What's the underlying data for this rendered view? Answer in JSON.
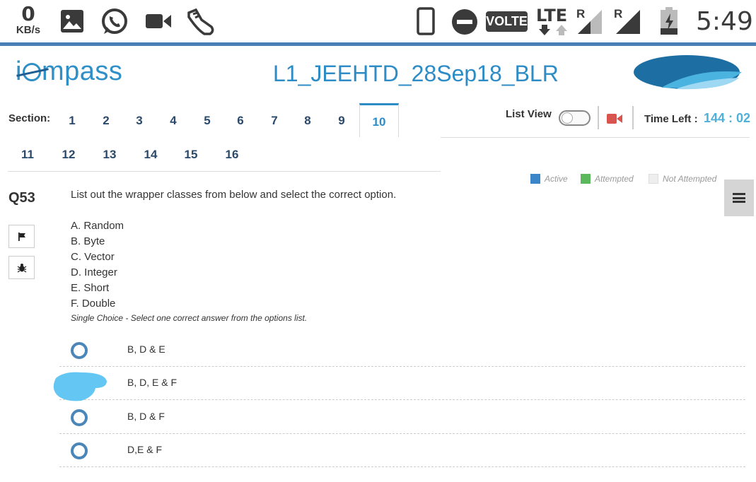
{
  "status_bar": {
    "speed_value": "0",
    "speed_unit": "KB/s",
    "volte": "VOLTE",
    "network": "LTE",
    "sim1": "R",
    "sim2": "R",
    "time": "5:49",
    "icons": [
      "image-icon",
      "whatsapp-icon",
      "video-camera-icon",
      "shoe-icon",
      "phone-icon",
      "do-not-disturb-icon",
      "lte-arrows-icon",
      "signal-icon",
      "battery-charging-icon"
    ]
  },
  "header": {
    "logo_left": "i",
    "logo_right": "mpass",
    "exam_title": "L1_JEEHTD_28Sep18_BLR"
  },
  "sections": {
    "label": "Section:",
    "items": [
      "1",
      "2",
      "3",
      "4",
      "5",
      "6",
      "7",
      "8",
      "9",
      "10",
      "11",
      "12",
      "13",
      "14",
      "15",
      "16"
    ],
    "active": "10"
  },
  "controls": {
    "list_view_label": "List View",
    "time_left_label": "Time Left :",
    "time_left_value": "144 : 02"
  },
  "legend": {
    "active": "Active",
    "attempted": "Attempted",
    "not_attempted": "Not Attempted",
    "colors": {
      "active": "#3b86c9",
      "attempted": "#5cb85c",
      "not_attempted": "#eeeeee"
    }
  },
  "question": {
    "number": "Q53",
    "text": "List out the wrapper classes from below  and select the correct option.",
    "options": [
      "A. Random",
      "B. Byte",
      "C. Vector",
      "D. Integer",
      "E. Short",
      "F. Double"
    ],
    "hint": "Single Choice - Select one correct answer from the options list."
  },
  "answers": [
    "B, D & E",
    "B, D, E & F",
    "B, D & F",
    "D,E & F"
  ]
}
